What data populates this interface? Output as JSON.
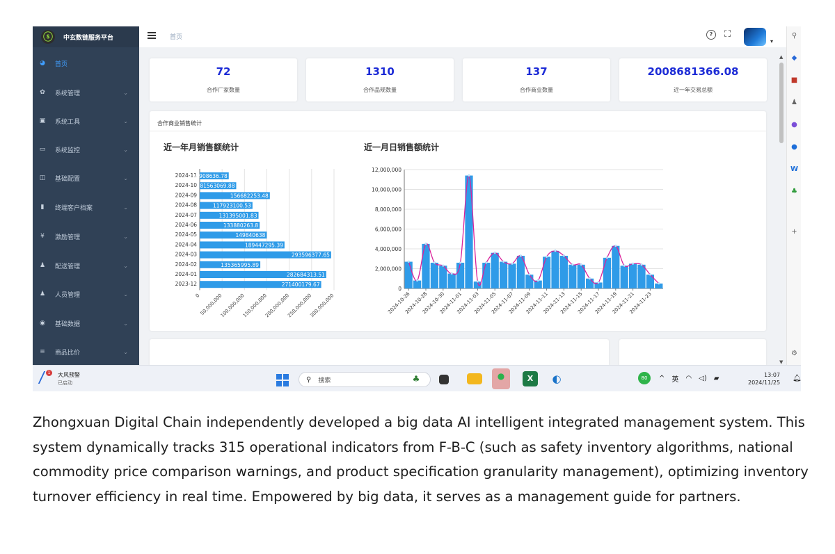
{
  "app": {
    "title": "中玄数链服务平台",
    "breadcrumb": "首页"
  },
  "sidebar": {
    "items": [
      {
        "label": "首页",
        "icon": "dashboard-icon",
        "active": true
      },
      {
        "label": "系统管理",
        "icon": "gear-icon"
      },
      {
        "label": "系统工具",
        "icon": "toolbox-icon"
      },
      {
        "label": "系统监控",
        "icon": "monitor-icon"
      },
      {
        "label": "基础配置",
        "icon": "book-icon"
      },
      {
        "label": "终端客户档案",
        "icon": "archive-icon"
      },
      {
        "label": "激励管理",
        "icon": "yen-icon"
      },
      {
        "label": "配送管理",
        "icon": "user-icon"
      },
      {
        "label": "人员管理",
        "icon": "user-icon"
      },
      {
        "label": "基础数据",
        "icon": "database-icon"
      },
      {
        "label": "商品比价",
        "icon": "list-icon"
      }
    ]
  },
  "stats": [
    {
      "value": "72",
      "label": "合作厂家数量"
    },
    {
      "value": "1310",
      "label": "合作品规数量"
    },
    {
      "value": "137",
      "label": "合作商业数量"
    },
    {
      "value": "2008681366.08",
      "label": "近一年交易总额"
    }
  ],
  "panel_title": "合作商业销售统计",
  "chart_data": [
    {
      "type": "bar",
      "orientation": "horizontal",
      "title": "近一年月销售额统计",
      "categories": [
        "2024-11",
        "2024-10",
        "2024-09",
        "2024-08",
        "2024-07",
        "2024-06",
        "2024-05",
        "2024-04",
        "2024-03",
        "2024-02",
        "2024-01",
        "2023-12"
      ],
      "values": [
        64908636.78,
        81563069.88,
        156682253.48,
        117923100.53,
        131395001.83,
        133880263.8,
        149840638,
        189447295.39,
        293596377.65,
        135365995.89,
        282684313.51,
        271400179.67
      ],
      "data_labels": [
        "64908636.78",
        "81563069.88",
        "156682253.48",
        "117923100.53",
        "131395001.83",
        "133880263.8",
        "149840638",
        "189447295.39",
        "293596377.65",
        "135365995.89",
        "282684313.51",
        "271400179.67"
      ],
      "xlim": [
        0,
        300000000
      ],
      "x_ticks": [
        "0",
        "50,000,000",
        "100,000,000",
        "150,000,000",
        "200,000,000",
        "250,000,000",
        "300,000,000"
      ],
      "color": "#2f9be8",
      "grid": true
    },
    {
      "type": "bar",
      "overlay": "line",
      "title": "近一月日销售额统计",
      "x_tick_labels": [
        "2024-10-26",
        "2024-10-28",
        "2024-10-30",
        "2024-11-01",
        "2024-11-03",
        "2024-11-05",
        "2024-11-07",
        "2024-11-09",
        "2024-11-11",
        "2024-11-13",
        "2024-11-15",
        "2024-11-17",
        "2024-11-19",
        "2024-11-21",
        "2024-11-23"
      ],
      "values": [
        2700000,
        800000,
        4500000,
        2600000,
        2300000,
        1500000,
        2600000,
        11400000,
        700000,
        2600000,
        3600000,
        2700000,
        2500000,
        3300000,
        1400000,
        800000,
        3200000,
        3800000,
        3300000,
        2400000,
        2400000,
        1000000,
        600000,
        3100000,
        4300000,
        2300000,
        2500000,
        2400000,
        1400000,
        500000
      ],
      "ylim": [
        0,
        12000000
      ],
      "y_ticks": [
        "0",
        "2,000,000",
        "4,000,000",
        "6,000,000",
        "8,000,000",
        "10,000,000",
        "12,000,000"
      ],
      "bar_color": "#2f9be8",
      "line_color": "#d8239b",
      "grid": true
    }
  ],
  "taskbar": {
    "warning_title": "大风预警",
    "warning_sub": "已启动",
    "warning_badge": "1",
    "search_placeholder": "搜索",
    "tray_badge": "80",
    "ime": "英",
    "time": "13:07",
    "date": "2024/11/25"
  },
  "caption": "Zhongxuan Digital Chain independently developed a big data AI intelligent integrated management system. This system dynamically tracks 315 operational indicators from F-B-C (such as safety inventory algorithms, national commodity price comparison warnings, and product specification granularity management), optimizing inventory turnover efficiency in real time. Empowered by big data, it serves as a management guide for partners."
}
